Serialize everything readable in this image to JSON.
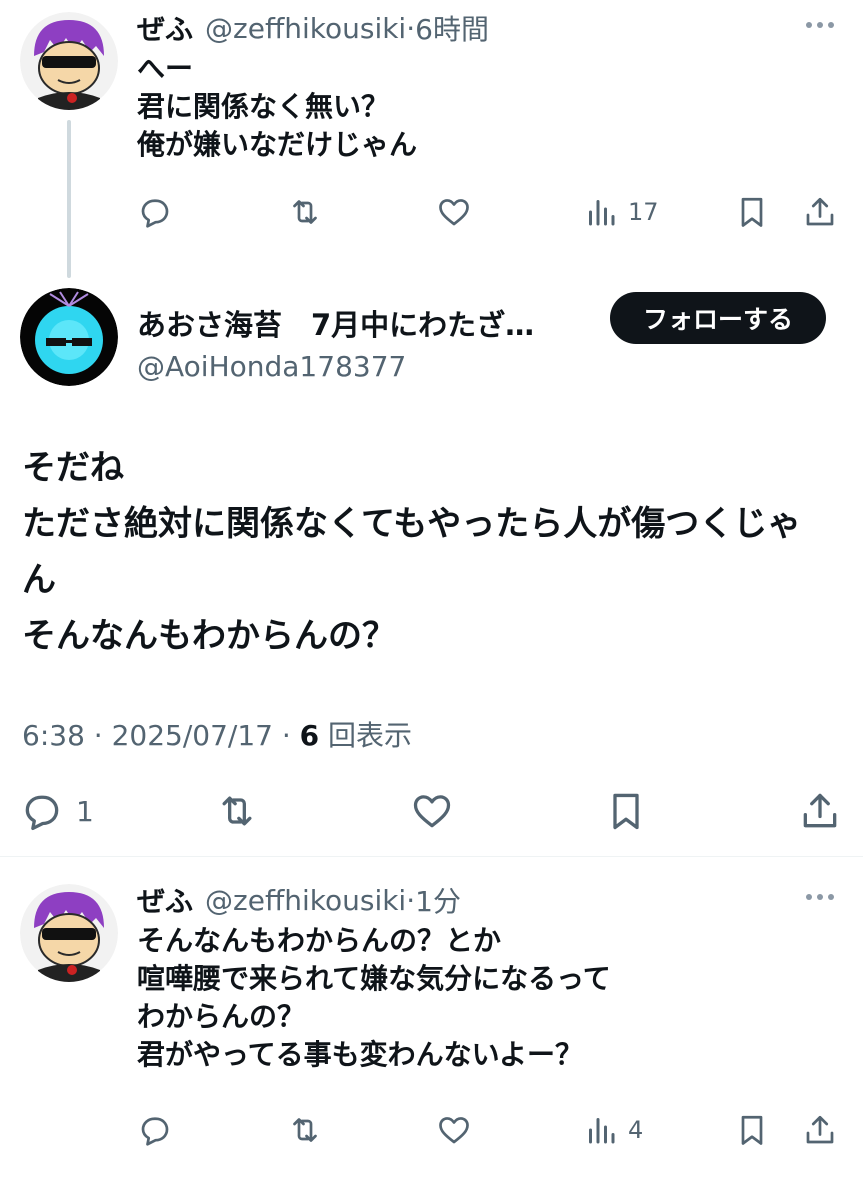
{
  "tweets": [
    {
      "display_name": "ぜふ",
      "handle": "@zeffhikousiki",
      "time": "6時間",
      "lines": [
        "へー",
        "君に関係なく無い？",
        "俺が嫌いなだけじゃん"
      ],
      "views": "17"
    },
    {
      "display_name": "あおさ海苔　7月中にわたざ…",
      "handle": "@AoiHonda178377",
      "follow_label": "フォローする",
      "lines": [
        "そだね",
        "たださ絶対に関係なくてもやったら人が傷つくじゃ",
        "ん",
        "そんなんもわからんの？"
      ],
      "timestamp": "6:38 · 2025/07/17 · ",
      "view_count": "6",
      "view_suffix": " 回表示",
      "reply_count": "1"
    },
    {
      "display_name": "ぜふ",
      "handle": "@zeffhikousiki",
      "time": "1分",
      "lines": [
        "そんなんもわからんの？とか",
        "喧嘩腰で来られて嫌な気分になるって",
        "わからんの？",
        "君がやってる事も変わんないよー？"
      ],
      "views": "4"
    }
  ],
  "separator": " · ",
  "colors": {
    "text": "#0f1419",
    "secondary": "#536471",
    "thread_line": "#cfd9de",
    "avatar_hair": "#8e3fc2",
    "avatar_glow": "#2fd6f0"
  },
  "icons": [
    "reply-icon",
    "retweet-icon",
    "like-icon",
    "views-icon",
    "bookmark-icon",
    "share-icon",
    "more-icon"
  ]
}
